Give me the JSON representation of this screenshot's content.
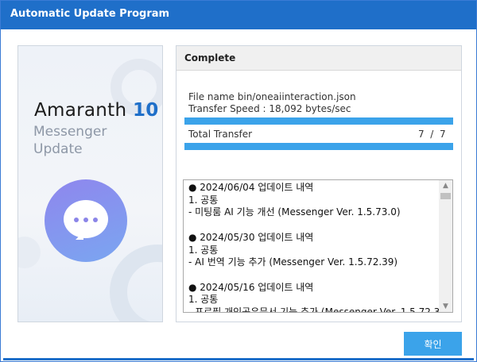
{
  "window": {
    "title": "Automatic Update Program"
  },
  "brand": {
    "name": "Amaranth",
    "version": "10",
    "subtitle_line1": "Messenger",
    "subtitle_line2": "Update",
    "accent_color": "#1f6fc9"
  },
  "status": {
    "header": "Complete",
    "file_name_line": "File name bin/oneaiinteraction.json",
    "transfer_speed_line": "Transfer Speed  : 18,092 bytes/sec",
    "file_progress": 1.0,
    "total_label": "Total Transfer",
    "total_current": "7",
    "total_separator": "/",
    "total_max": "7",
    "total_progress": 1.0,
    "progress_color": "#3ba3ea"
  },
  "changelog": [
    {
      "heading": "● 2024/06/04 업데이트 내역",
      "category": "1. 공통",
      "item": " - 미팅룸 AI 기능 개선 (Messenger Ver. 1.5.73.0)"
    },
    {
      "heading": "● 2024/05/30 업데이트 내역",
      "category": "1. 공통",
      "item": " - AI 번역 기능 추가 (Messenger Ver. 1.5.72.39)"
    },
    {
      "heading": "● 2024/05/16 업데이트 내역",
      "category": "1. 공통",
      "item": " - 프로필 개인공유문서 기능 추가 (Messenger Ver. 1.5.72.3"
    }
  ],
  "buttons": {
    "ok_label": "확인"
  }
}
